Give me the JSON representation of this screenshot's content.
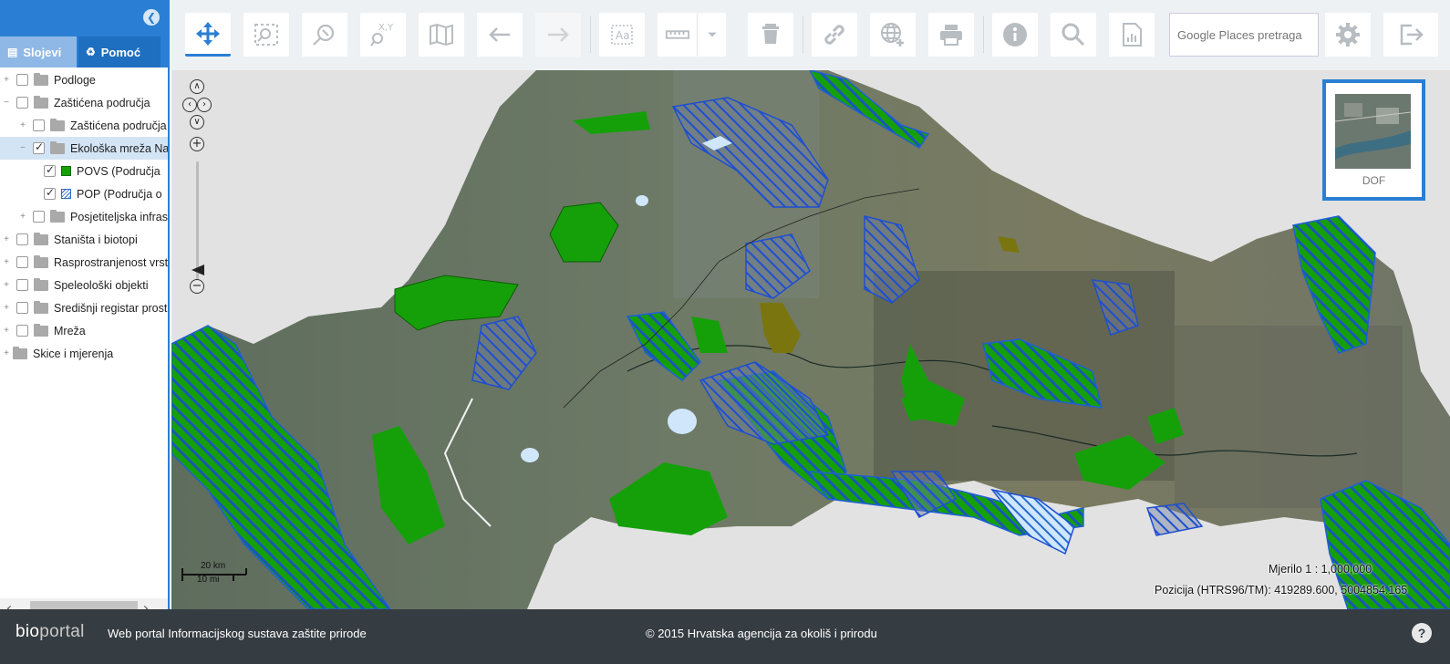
{
  "sidebar": {
    "tabs": [
      {
        "label": "Slojevi",
        "icon": "layers-icon"
      },
      {
        "label": "Pomoć",
        "icon": "help-doc-icon"
      }
    ],
    "tree": [
      {
        "label": "Podloge",
        "type": "folder",
        "level": 0,
        "checked": false
      },
      {
        "label": "Zaštićena područja",
        "type": "folder",
        "level": 0,
        "checked": false
      },
      {
        "label": "Zaštićena područja",
        "type": "folder",
        "level": 1,
        "checked": false
      },
      {
        "label": "Ekološka mreža Na",
        "type": "folder",
        "level": 1,
        "checked": true,
        "selected": true
      },
      {
        "label": "POVS (Područja",
        "type": "layer-green",
        "level": 2,
        "checked": true
      },
      {
        "label": "POP (Područja o",
        "type": "layer-hatch",
        "level": 2,
        "checked": true
      },
      {
        "label": "Posjetiteljska infras",
        "type": "folder",
        "level": 1,
        "checked": false
      },
      {
        "label": "Staništa i biotopi",
        "type": "folder",
        "level": 0,
        "checked": false
      },
      {
        "label": "Rasprostranjenost vrst",
        "type": "folder",
        "level": 0,
        "checked": false
      },
      {
        "label": "Speleološki objekti",
        "type": "folder",
        "level": 0,
        "checked": false
      },
      {
        "label": "Središnji registar prost",
        "type": "folder",
        "level": 0,
        "checked": false
      },
      {
        "label": "Mreža",
        "type": "folder",
        "level": 0,
        "checked": false
      },
      {
        "label": "Skice i mjerenja",
        "type": "folder",
        "level": -1,
        "checked": false
      }
    ]
  },
  "toolbar": {
    "search_placeholder": "Google Places pretraga",
    "buttons": [
      "pan-icon",
      "zoom-box-icon",
      "zoom-region-icon",
      "xy-coordinates-icon",
      "map-icon",
      "back-arrow-icon",
      "forward-arrow-icon",
      "text-icon",
      "measure-icon",
      "dropdown-icon",
      "delete-icon",
      "link-icon",
      "globe-add-icon",
      "print-icon",
      "info-icon",
      "search-icon",
      "report-icon",
      "settings-icon",
      "logout-icon"
    ]
  },
  "map": {
    "overview_label": "DOF",
    "scale_km": "20 km",
    "scale_mi": "10 mi",
    "scale_text": "Mjerilo 1 : 1,000,000",
    "position_text": "Pozicija (HTRS96/TM):  419289.600, 5004854.165",
    "colors": {
      "povs": "#14a000",
      "pop": "#1f5fd6",
      "background": "#e2e2e2"
    }
  },
  "footer": {
    "logo_part1": "bio",
    "logo_part2": "portal",
    "description": "Web portal Informacijskog sustava zaštite prirode",
    "copyright": "© 2015 Hrvatska agencija za okoliš i prirodu"
  }
}
